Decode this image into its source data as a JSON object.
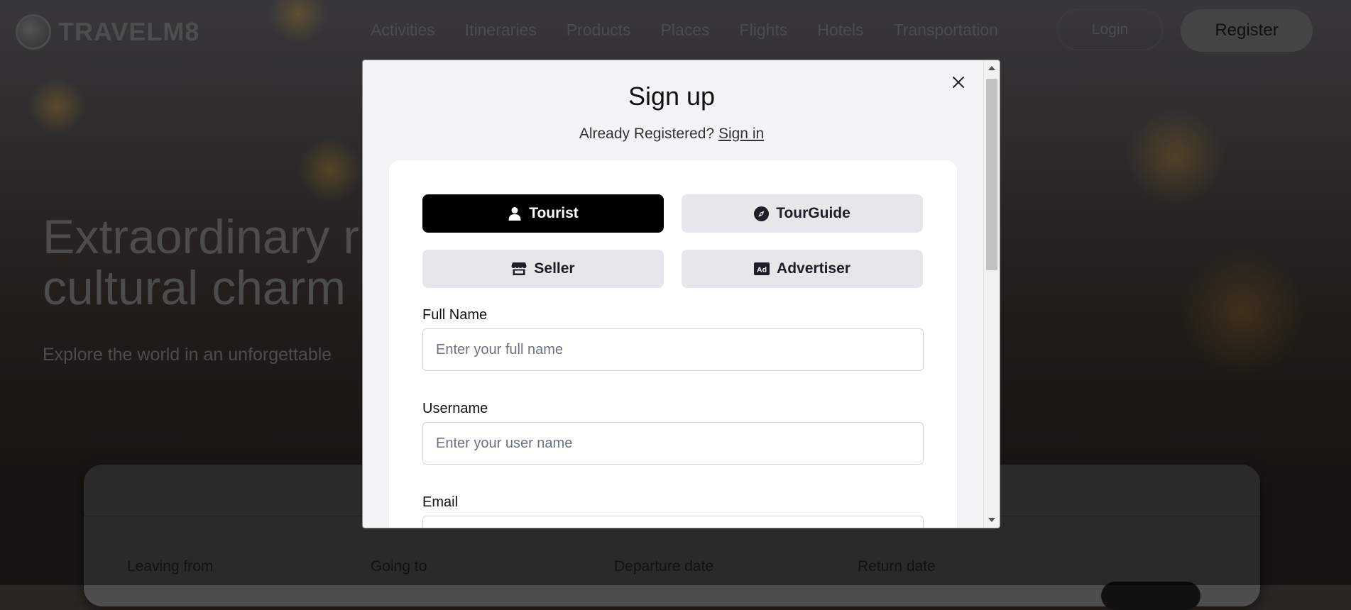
{
  "site": {
    "brand": "TRAVELM8",
    "nav": [
      "Activities",
      "Itineraries",
      "Products",
      "Places",
      "Flights",
      "Hotels",
      "Transportation"
    ],
    "login_label": "Login",
    "register_label": "Register",
    "hero_title": "Extraordinary r cultural charm",
    "hero_subtitle": "Explore the world in an unforgettable",
    "search_fields": [
      "Leaving from",
      "Going to",
      "Departure date",
      "Return date"
    ]
  },
  "modal": {
    "title": "Sign up",
    "already_registered": "Already Registered?",
    "sign_in_link": "Sign in",
    "roles": [
      {
        "label": "Tourist",
        "icon": "user-icon",
        "selected": true
      },
      {
        "label": "TourGuide",
        "icon": "compass-icon",
        "selected": false
      },
      {
        "label": "Seller",
        "icon": "store-icon",
        "selected": false
      },
      {
        "label": "Advertiser",
        "icon": "ad-icon",
        "selected": false
      }
    ],
    "fields": {
      "full_name": {
        "label": "Full Name",
        "placeholder": "Enter your full name",
        "value": ""
      },
      "username": {
        "label": "Username",
        "placeholder": "Enter your user name",
        "value": ""
      },
      "email": {
        "label": "Email"
      }
    }
  },
  "colors": {
    "selected_role_bg": "#000000",
    "role_bg": "#e5e7eb",
    "modal_bg": "#f3f4f6",
    "card_bg": "#ffffff"
  }
}
